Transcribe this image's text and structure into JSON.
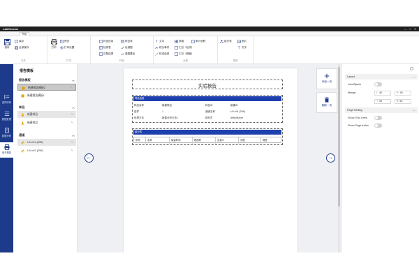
{
  "app": {
    "title": "LabChrome",
    "window_controls": [
      "—",
      "□",
      "✕"
    ]
  },
  "ribbon": {
    "tab": "开始",
    "groups": {
      "file": {
        "label": "文件",
        "save": "保存",
        "save_all": "全部保存"
      },
      "print": {
        "label": "打印",
        "print": "打印",
        "preview": "预览",
        "print_setup": "打印设置"
      },
      "sample": {
        "label": "样品",
        "items": [
          "样品信息",
          "样品表",
          "检测表",
          "色谱图",
          "匹配结果",
          "谱图叠加"
        ]
      },
      "elements": {
        "label": "元素",
        "items": [
          "文本",
          "表格",
          "审计追踪",
          "积分事件",
          "汇总（检测）",
          "校准曲线",
          "汇总（峰值）"
        ]
      },
      "graphic": {
        "label": "图形",
        "items": [
          "组分表",
          "图片",
          "文字"
        ]
      }
    }
  },
  "sidebar": {
    "items": [
      {
        "label": "进样序列"
      },
      {
        "label": "数据处理"
      },
      {
        "label": "数据分析"
      },
      {
        "label": "电子报告"
      }
    ]
  },
  "templates": {
    "title": "报告模板",
    "sections": [
      {
        "name": "报告模板",
        "items": [
          "新建报告模板2",
          "新建报告模板1"
        ]
      },
      {
        "name": "样品",
        "items": [
          "新建样品",
          "新建样品"
        ]
      },
      {
        "name": "通道",
        "items": [
          "UV-ch1-(256)",
          "UV-ch2-(256)"
        ]
      }
    ]
  },
  "page": {
    "report_title": "实验报告",
    "section1": {
      "bar": "样品信息",
      "rows": [
        [
          "样品名称",
          "新建样品",
          "样品ID",
          "新建ID"
        ],
        [
          "进样",
          "1",
          "通道名称",
          "UV-ch1-(256)"
        ],
        [
          "处理方法",
          "新建分析方法1",
          "操作员",
          "defaultUser"
        ]
      ]
    },
    "section2": {
      "bar": "组分表",
      "columns": [
        "序号",
        "名称",
        "保留时间",
        "峰面积",
        "含量%",
        "浓度",
        "峰宽"
      ]
    }
  },
  "page_tools": {
    "add": "添加一页",
    "delete": "删除一页"
  },
  "properties": {
    "layout": {
      "label": "Layout",
      "landscape": "LandSpace",
      "margin": "Margin",
      "left_label": "L",
      "left": "40",
      "right_label": "R",
      "right": "40",
      "top_label": "T",
      "top": "50",
      "bottom_label": "B",
      "bottom": "50"
    },
    "page_setting": {
      "label": "Page Setting",
      "grid": "Show Grid Lines",
      "index": "Show Page Index"
    }
  },
  "colors": {
    "primary": "#1e3a8a",
    "accent": "#1e40af",
    "selected_bg": "#c8c8c8"
  }
}
